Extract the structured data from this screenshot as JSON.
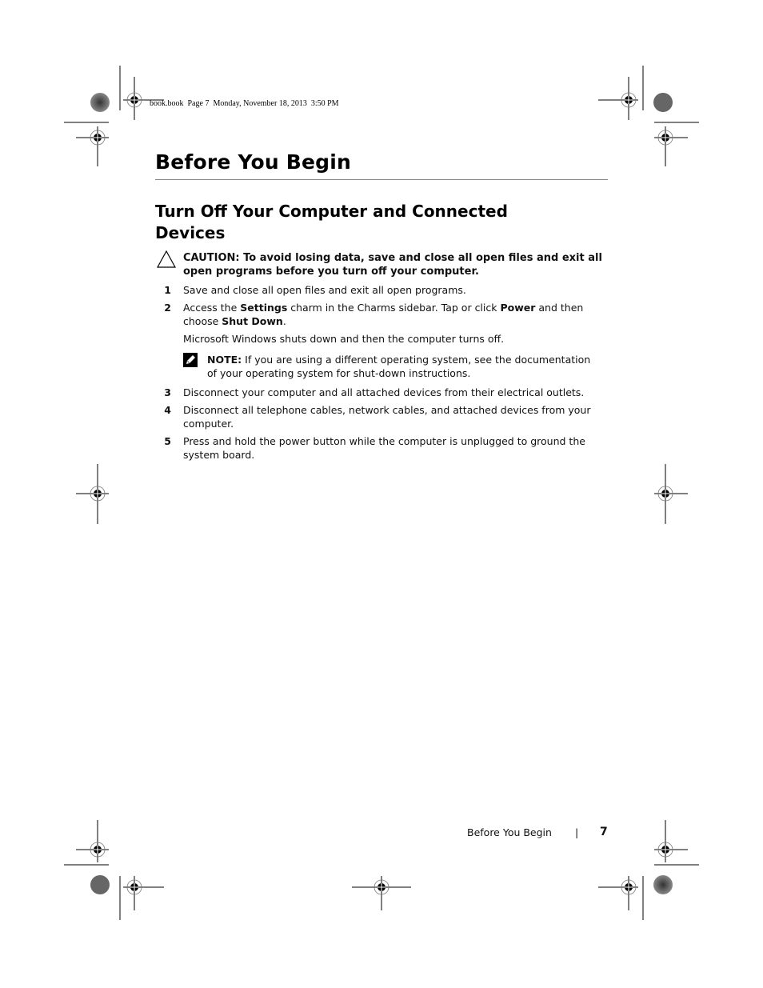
{
  "slug": "book.book  Page 7  Monday, November 18, 2013  3:50 PM",
  "chapter_title": "Before You Begin",
  "section_title": "Turn Off Your Computer and Connected Devices",
  "caution": {
    "icon": "caution-triangle-icon",
    "label": "CAUTION:",
    "text": " To avoid losing data, save and close all open files and exit all open programs before you turn off your computer."
  },
  "steps": [
    {
      "num": "1",
      "text": "Save and close all open files and exit all open programs."
    },
    {
      "num": "2",
      "parts": [
        "Access the ",
        "Settings",
        " charm in the Charms sidebar. Tap or click ",
        "Power",
        " and then choose ",
        "Shut Down",
        "."
      ]
    },
    {
      "num": "3",
      "text": "Disconnect your computer and all attached devices from their electrical outlets."
    },
    {
      "num": "4",
      "text": "Disconnect all telephone cables, network cables, and attached devices from your computer."
    },
    {
      "num": "5",
      "text": "Press and hold the power button while the computer is unplugged to ground the system board."
    }
  ],
  "step2_followup": "Microsoft Windows shuts down and then the computer turns off.",
  "note": {
    "icon": "note-pencil-icon",
    "label": "NOTE:",
    "text": " If you are using a different operating system, see the documentation of your operating system for shut-down instructions."
  },
  "footer": {
    "title": "Before You Begin",
    "separator": "|",
    "page": "7"
  }
}
